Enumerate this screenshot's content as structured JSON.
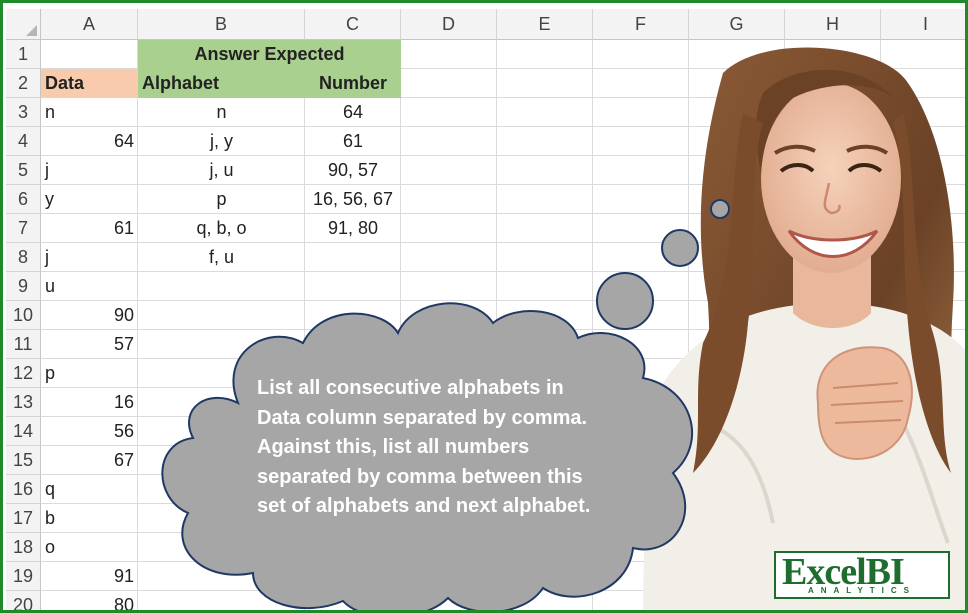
{
  "columns": [
    "A",
    "B",
    "C",
    "D",
    "E",
    "F",
    "G",
    "H",
    "I"
  ],
  "rows": [
    "1",
    "2",
    "3",
    "4",
    "5",
    "6",
    "7",
    "8",
    "9",
    "10",
    "11",
    "12",
    "13",
    "14",
    "15",
    "16",
    "17",
    "18",
    "19",
    "20"
  ],
  "header": {
    "answer_expected": "Answer Expected",
    "data": "Data",
    "alphabet": "Alphabet",
    "number": "Number"
  },
  "data_col": [
    "n",
    "64",
    "j",
    "y",
    "61",
    "j",
    "u",
    "90",
    "57",
    "p",
    "16",
    "56",
    "67",
    "q",
    "b",
    "o",
    "91",
    "80"
  ],
  "answer": [
    {
      "alphabet": "n",
      "number": "64"
    },
    {
      "alphabet": "j, y",
      "number": "61"
    },
    {
      "alphabet": "j, u",
      "number": "90, 57"
    },
    {
      "alphabet": "p",
      "number": "16, 56, 67"
    },
    {
      "alphabet": "q, b, o",
      "number": "91, 80"
    },
    {
      "alphabet": "f, u",
      "number": ""
    }
  ],
  "callout": {
    "text": "List all consecutive alphabets in Data column separated by comma. Against this, list all numbers separated by comma between this set of alphabets and next alphabet."
  },
  "logo": {
    "main": "Excel",
    "bi": "BI",
    "sub": "ANALYTICS"
  },
  "colors": {
    "frame": "#1f8a2a",
    "header_green": "#a9d08e",
    "data_orange": "#f8cbad",
    "cloud": "#a6a6a6",
    "cloud_border": "#203864"
  }
}
